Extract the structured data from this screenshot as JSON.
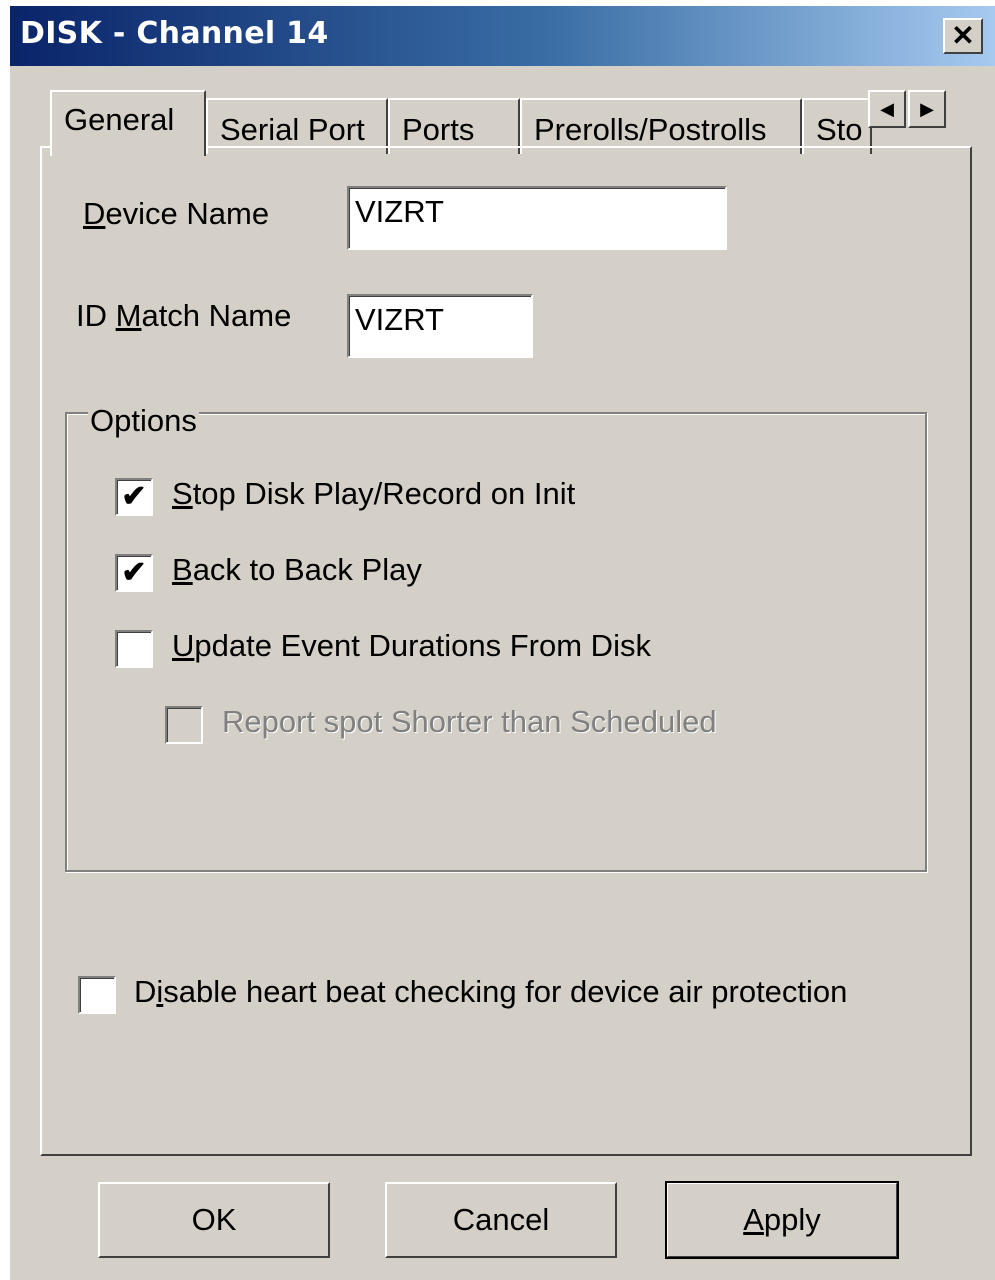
{
  "window": {
    "title": "DISK - Channel 14",
    "close_glyph": "✕",
    "close_icon": "close-icon"
  },
  "tabs": [
    {
      "label": "General",
      "active": true
    },
    {
      "label": "Serial Port",
      "active": false
    },
    {
      "label": "Ports",
      "active": false
    },
    {
      "label": "Prerolls/Postrolls",
      "active": false
    },
    {
      "label": "Sto",
      "active": false
    }
  ],
  "tab_scroll": {
    "left_icon": "arrow-left-icon",
    "right_icon": "arrow-right-icon"
  },
  "general": {
    "device_name": {
      "label_prefix": "",
      "label_access": "D",
      "label_rest": "evice Name",
      "value": "VIZRT"
    },
    "id_match_name": {
      "label_prefix": "ID ",
      "label_access": "M",
      "label_rest": "atch Name",
      "value": "VIZRT"
    },
    "options": {
      "title": "Options",
      "items": [
        {
          "access": "S",
          "rest": "top Disk Play/Record on Init",
          "checked": true,
          "enabled": true
        },
        {
          "access": "B",
          "rest": "ack to Back Play",
          "checked": true,
          "enabled": true
        },
        {
          "access": "U",
          "rest": "pdate Event Durations From Disk",
          "checked": false,
          "enabled": true
        },
        {
          "access": "",
          "rest": "Report spot Shorter than Scheduled",
          "checked": false,
          "enabled": false
        }
      ]
    },
    "heartbeat": {
      "prefix": "D",
      "access": "i",
      "rest": "sable heart beat checking for device air protection",
      "checked": false
    }
  },
  "buttons": {
    "ok": "OK",
    "cancel": "Cancel",
    "apply_access": "A",
    "apply_rest": "pply"
  },
  "check_glyph": "✔"
}
